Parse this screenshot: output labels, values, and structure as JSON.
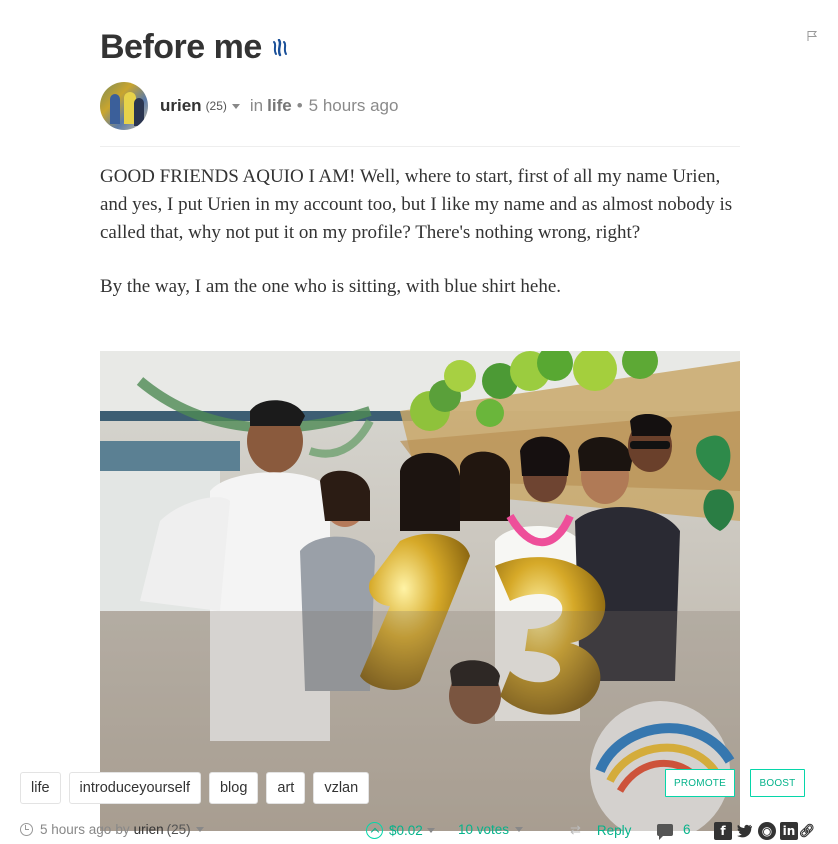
{
  "post": {
    "title": "Before me",
    "author": "urien",
    "reputation": "(25)",
    "in_label": "in",
    "category": "life",
    "separator": "•",
    "time_ago": "5 hours ago",
    "paragraphs": [
      "GOOD FRIENDS AQUIO I AM! Well, where to start, first of all my name Urien, and yes, I put Urien in my account too, but I like my name and as almost nobody is called that, why not put it on my profile? There's nothing wrong, right?",
      "By the way, I am the one who is sitting, with blue shirt hehe."
    ]
  },
  "tags": [
    "life",
    "introduceyourself",
    "blog",
    "art",
    "vzlan"
  ],
  "actions": {
    "promote": "PROMOTE",
    "boost": "BOOST"
  },
  "footer": {
    "time_ago": "5 hours ago",
    "by_label": "by",
    "author": "urien",
    "reputation": "(25)",
    "payout": "$0.02",
    "votes": "10 votes",
    "reply": "Reply",
    "comments": "6"
  },
  "share": {
    "icons": [
      "facebook-icon",
      "twitter-icon",
      "reddit-icon",
      "linkedin-icon",
      "link-icon"
    ],
    "facebook": "f",
    "linkedin": "in"
  },
  "colors": {
    "accent": "#06d6a9",
    "accent_text": "#06b38b",
    "text": "#333333",
    "muted": "#888888"
  }
}
